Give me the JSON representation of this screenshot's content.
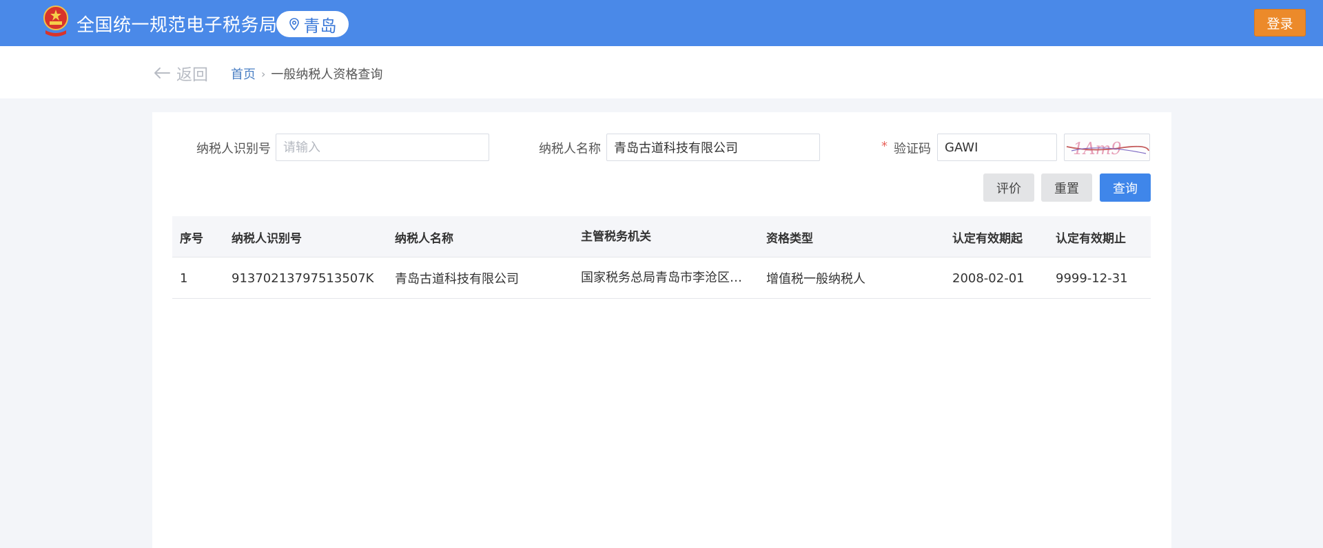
{
  "header": {
    "site_title": "全国统一规范电子税务局",
    "city": "青岛",
    "login_label": "登录",
    "icons": [
      "national-emblem-icon",
      "location-pin-icon"
    ]
  },
  "breadcrumb": {
    "back_label": "返回",
    "home": "首页",
    "separator": "›",
    "current": "一般纳税人资格查询"
  },
  "form": {
    "taxpayer_id_label": "纳税人识别号",
    "taxpayer_id_placeholder": "请输入",
    "taxpayer_id_value": "",
    "taxpayer_name_label": "纳税人名称",
    "taxpayer_name_value": "青岛古道科技有限公司",
    "required_mark": "*",
    "captcha_label": "验证码",
    "captcha_value": "GAWI",
    "captcha_image_text": "1Am9"
  },
  "actions": {
    "evaluate": "评价",
    "reset": "重置",
    "query": "查询"
  },
  "table": {
    "columns": [
      "序号",
      "纳税人识别号",
      "纳税人名称",
      "主管税务机关",
      "资格类型",
      "认定有效期起",
      "认定有效期止"
    ],
    "rows": [
      [
        "1",
        "91370213797513507K",
        "青岛古道科技有限公司",
        "国家税务总局青岛市李沧区税...",
        "增值税一般纳税人",
        "2008-02-01",
        "9999-12-31"
      ]
    ]
  },
  "colors": {
    "header_blue": "#4a89e8",
    "login_orange": "#ec8a2a",
    "primary_button": "#3f86ea",
    "link_blue": "#4a7fc4"
  }
}
